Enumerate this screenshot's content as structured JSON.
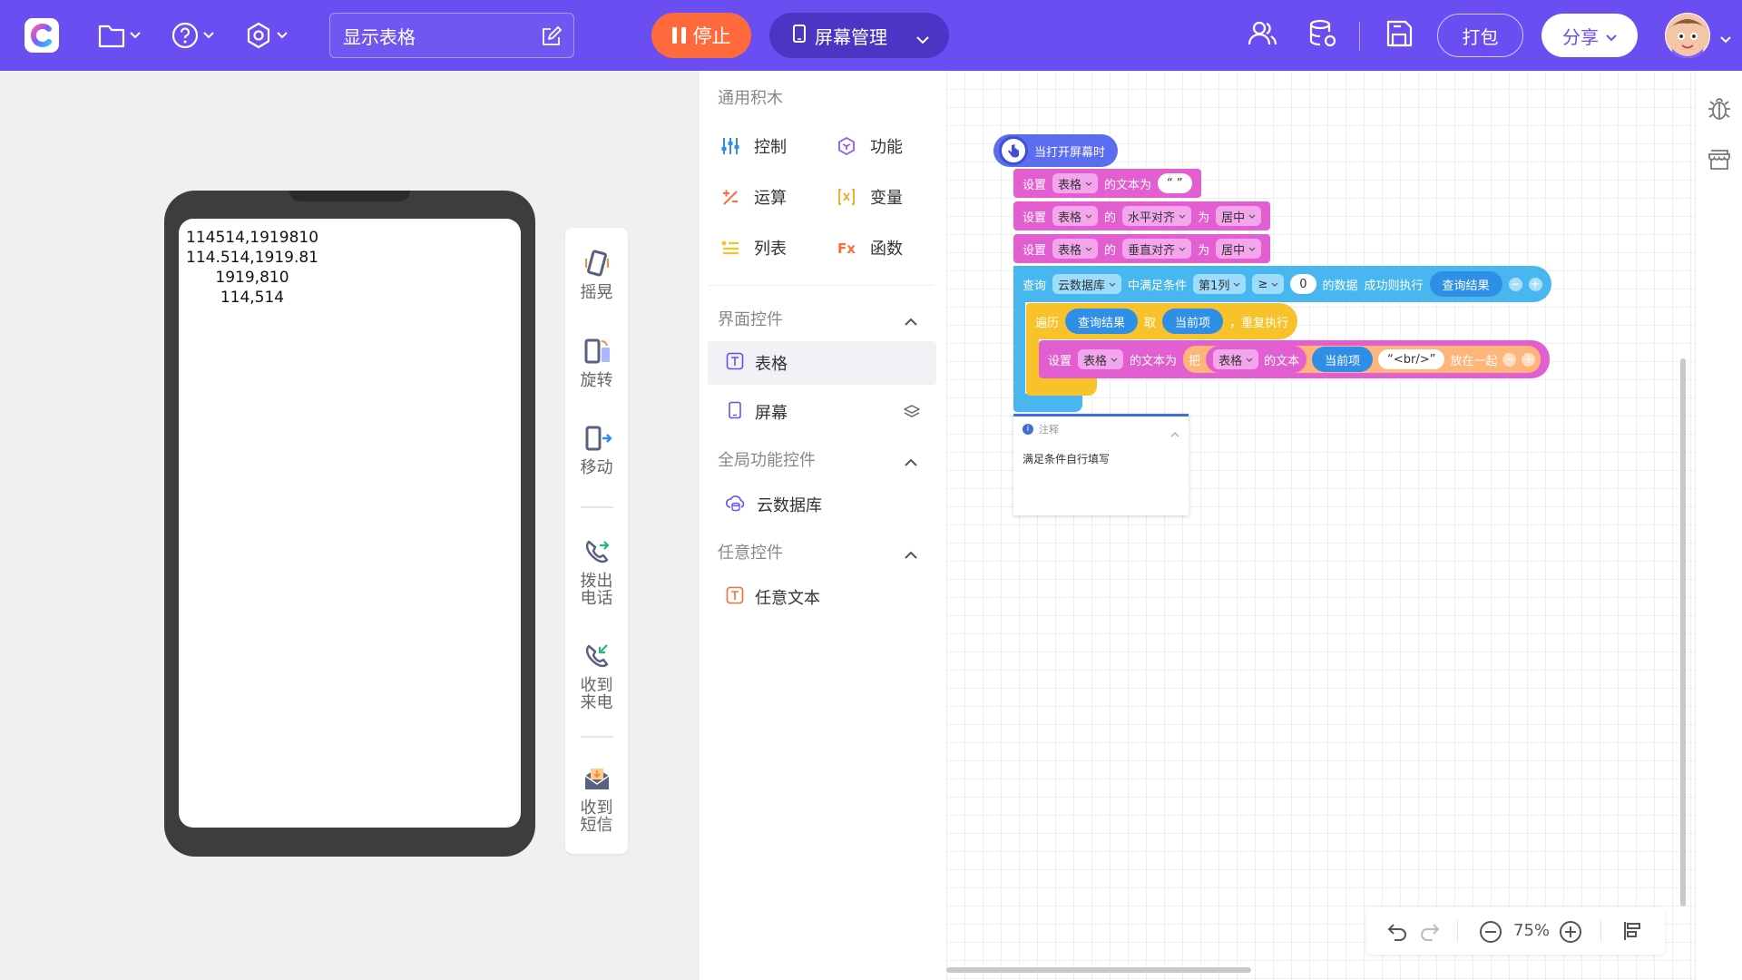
{
  "topbar": {
    "screen_name": "显示表格",
    "stop_label": "停止",
    "screen_manage_label": "屏幕管理",
    "pack_label": "打包",
    "share_label": "分享"
  },
  "preview": {
    "rows": [
      "114514,1919810",
      "114.514,1919.81",
      "      1919,810",
      "       114,514"
    ]
  },
  "side_tools": [
    {
      "label": "摇晃",
      "icon": "shake-icon"
    },
    {
      "label": "旋转",
      "icon": "rotate-icon"
    },
    {
      "label": "移动",
      "icon": "move-icon"
    },
    {
      "label": "拨出电话",
      "line1": "拨出",
      "line2": "电话",
      "icon": "phone-out-icon"
    },
    {
      "label": "收到来电",
      "line1": "收到",
      "line2": "来电",
      "icon": "phone-in-icon"
    },
    {
      "label": "收到短信",
      "line1": "收到",
      "line2": "短信",
      "icon": "sms-icon"
    }
  ],
  "panel": {
    "general_header": "通用积木",
    "categories": {
      "control": "控制",
      "function": "功能",
      "operation": "运算",
      "variable": "变量",
      "list": "列表",
      "func": "函数"
    },
    "ui_header": "界面控件",
    "ui_items": {
      "table": "表格",
      "screen": "屏幕"
    },
    "global_header": "全局功能控件",
    "global_items": {
      "clouddb": "云数据库"
    },
    "any_header": "任意控件",
    "any_items": {
      "anytext": "任意文本"
    }
  },
  "blocks": {
    "hat": "当打开屏幕时",
    "b1": {
      "set": "设置",
      "comp": "表格",
      "text_as": "的文本为",
      "value": "“ ”"
    },
    "b2": {
      "set": "设置",
      "comp": "表格",
      "of": "的",
      "prop": "水平对齐",
      "as": "为",
      "value": "居中"
    },
    "b3": {
      "set": "设置",
      "comp": "表格",
      "of": "的",
      "prop": "垂直对齐",
      "as": "为",
      "value": "居中"
    },
    "query": {
      "label": "查询",
      "db": "云数据库",
      "cond": "中满足条件",
      "col": "第1列",
      "op": "≥",
      "num": "0",
      "data": "的数据",
      "success": "成功则执行",
      "result": "查询结果"
    },
    "loop": {
      "label": "遍历",
      "result": "查询结果",
      "take": "取",
      "item": "当前项",
      "repeat": "，重复执行"
    },
    "inner": {
      "set": "设置",
      "comp": "表格",
      "text_as": "的文本为",
      "ba": "把",
      "comp2": "表格",
      "text": "的文本",
      "item": "当前项",
      "str": "“<br/>”",
      "join": "放在一起"
    }
  },
  "comment": {
    "title": "注释",
    "body": "满足条件自行填写"
  },
  "zoom": {
    "level": "75%"
  }
}
